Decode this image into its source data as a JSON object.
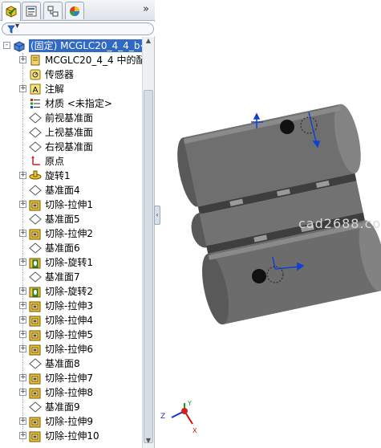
{
  "tabs": [
    {
      "name": "featuremanager",
      "active": true
    },
    {
      "name": "propertymanager",
      "active": false
    },
    {
      "name": "configurationmanager",
      "active": false
    },
    {
      "name": "displaymanager",
      "active": false
    }
  ],
  "tabs_more": "»",
  "filter_symbol": "▾",
  "tree": [
    {
      "label": "(固定) MCGLC20_4_4_b<",
      "icon": "part-icon",
      "level": 0,
      "expander": "-",
      "selected": true
    },
    {
      "label": "MCGLC20_4_4 中的配",
      "icon": "design-binder-icon",
      "level": 1,
      "expander": "+"
    },
    {
      "label": "传感器",
      "icon": "sensor-icon",
      "level": 1,
      "expander": ""
    },
    {
      "label": "注解",
      "icon": "annotation-icon",
      "level": 1,
      "expander": "+"
    },
    {
      "label": "材质 <未指定>",
      "icon": "material-icon",
      "level": 1,
      "expander": ""
    },
    {
      "label": "前视基准面",
      "icon": "plane-icon",
      "level": 1,
      "expander": ""
    },
    {
      "label": "上视基准面",
      "icon": "plane-icon",
      "level": 1,
      "expander": ""
    },
    {
      "label": "右视基准面",
      "icon": "plane-icon",
      "level": 1,
      "expander": ""
    },
    {
      "label": "原点",
      "icon": "origin-icon",
      "level": 1,
      "expander": ""
    },
    {
      "label": "旋转1",
      "icon": "revolve-icon",
      "level": 1,
      "expander": "+"
    },
    {
      "label": "基准面4",
      "icon": "plane-icon",
      "level": 1,
      "expander": ""
    },
    {
      "label": "切除-拉伸1",
      "icon": "cut-extrude-icon",
      "level": 1,
      "expander": "+"
    },
    {
      "label": "基准面5",
      "icon": "plane-icon",
      "level": 1,
      "expander": ""
    },
    {
      "label": "切除-拉伸2",
      "icon": "cut-extrude-icon",
      "level": 1,
      "expander": "+"
    },
    {
      "label": "基准面6",
      "icon": "plane-icon",
      "level": 1,
      "expander": ""
    },
    {
      "label": "切除-旋转1",
      "icon": "cut-revolve-icon",
      "level": 1,
      "expander": "+"
    },
    {
      "label": "基准面7",
      "icon": "plane-icon",
      "level": 1,
      "expander": ""
    },
    {
      "label": "切除-旋转2",
      "icon": "cut-revolve-icon",
      "level": 1,
      "expander": "+"
    },
    {
      "label": "切除-拉伸3",
      "icon": "cut-extrude-icon",
      "level": 1,
      "expander": "+"
    },
    {
      "label": "切除-拉伸4",
      "icon": "cut-extrude-icon",
      "level": 1,
      "expander": "+"
    },
    {
      "label": "切除-拉伸5",
      "icon": "cut-extrude-icon",
      "level": 1,
      "expander": "+"
    },
    {
      "label": "切除-拉伸6",
      "icon": "cut-extrude-icon",
      "level": 1,
      "expander": "+"
    },
    {
      "label": "基准面8",
      "icon": "plane-icon",
      "level": 1,
      "expander": ""
    },
    {
      "label": "切除-拉伸7",
      "icon": "cut-extrude-icon",
      "level": 1,
      "expander": "+"
    },
    {
      "label": "切除-拉伸8",
      "icon": "cut-extrude-icon",
      "level": 1,
      "expander": "+"
    },
    {
      "label": "基准面9",
      "icon": "plane-icon",
      "level": 1,
      "expander": ""
    },
    {
      "label": "切除-拉伸9",
      "icon": "cut-extrude-icon",
      "level": 1,
      "expander": "+"
    },
    {
      "label": "切除-拉伸10",
      "icon": "cut-extrude-icon",
      "level": 1,
      "expander": "+"
    }
  ],
  "viewport": {
    "watermark": "cad2688.co",
    "triad": {
      "x": "X",
      "y": "Y",
      "z": "Z"
    }
  },
  "colors": {
    "selection": "#3169c6",
    "part_body": "#6f6f6f",
    "axis_x": "#d01010",
    "axis_y": "#10a010",
    "axis_z": "#1030d0"
  }
}
